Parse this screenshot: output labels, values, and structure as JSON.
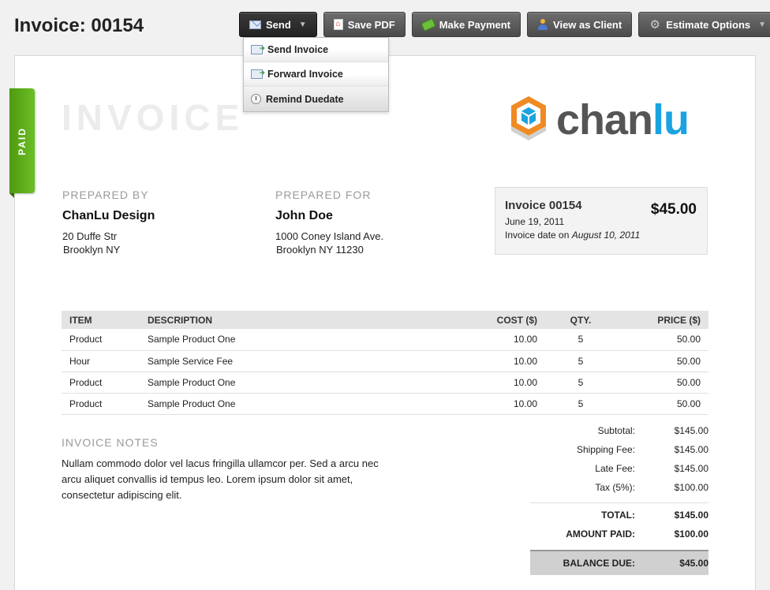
{
  "page": {
    "title": "Invoice: 00154"
  },
  "toolbar": {
    "send": "Send",
    "save_pdf": "Save PDF",
    "make_payment": "Make Payment",
    "view_as_client": "View as Client",
    "estimate_options": "Estimate Options"
  },
  "send_menu": {
    "send_invoice": "Send Invoice",
    "forward_invoice": "Forward Invoice",
    "remind_duedate": "Remind Duedate"
  },
  "status_badge": "PAID",
  "document": {
    "heading": "INVOICE"
  },
  "logo": {
    "text_a": "chan",
    "text_b": "lu",
    "text_c": ""
  },
  "prepared_by": {
    "label": "PREPARED BY",
    "name": "ChanLu Design",
    "address_line1": "20 Duffe Str",
    "address_line2": "Brooklyn NY"
  },
  "prepared_for": {
    "label": "PREPARED FOR",
    "name": "John Doe",
    "address_line1": "1000 Coney Island Ave.",
    "address_line2": "Brooklyn NY 11230"
  },
  "summary": {
    "invoice_no": "Invoice 00154",
    "date": "June 19, 2011",
    "invoice_date_label": "Invoice date on",
    "invoice_date": "August 10, 2011",
    "amount": "$45.00"
  },
  "items_table": {
    "headers": {
      "item": "ITEM",
      "description": "DESCRIPTION",
      "cost": "COST ($)",
      "qty": "QTY.",
      "price": "PRICE ($)"
    },
    "rows": [
      {
        "item": "Product",
        "description": "Sample Product One",
        "cost": "10.00",
        "qty": "5",
        "price": "50.00"
      },
      {
        "item": "Hour",
        "description": "Sample Service Fee",
        "cost": "10.00",
        "qty": "5",
        "price": "50.00"
      },
      {
        "item": "Product",
        "description": "Sample Product One",
        "cost": "10.00",
        "qty": "5",
        "price": "50.00"
      },
      {
        "item": "Product",
        "description": "Sample Product One",
        "cost": "10.00",
        "qty": "5",
        "price": "50.00"
      }
    ]
  },
  "notes": {
    "label": "INVOICE NOTES",
    "text": "Nullam commodo dolor vel lacus fringilla ullamcor per. Sed a arcu nec arcu aliquet convallis id tempus leo. Lorem ipsum dolor sit amet, consectetur adipiscing elit."
  },
  "totals": {
    "subtotal_label": "Subtotal:",
    "subtotal": "$145.00",
    "shipping_label": "Shipping Fee:",
    "shipping": "$145.00",
    "late_label": "Late Fee:",
    "late": "$145.00",
    "tax_label": "Tax (5%):",
    "tax": "$100.00",
    "total_label": "TOTAL:",
    "total": "$145.00",
    "paid_label": "AMOUNT PAID:",
    "paid": "$100.00",
    "balance_label": "BALANCE DUE:",
    "balance": "$45.00"
  },
  "colors": {
    "paid_green": "#5aab1a",
    "logo_orange": "#f08a24",
    "logo_blue": "#1aa3e0"
  }
}
